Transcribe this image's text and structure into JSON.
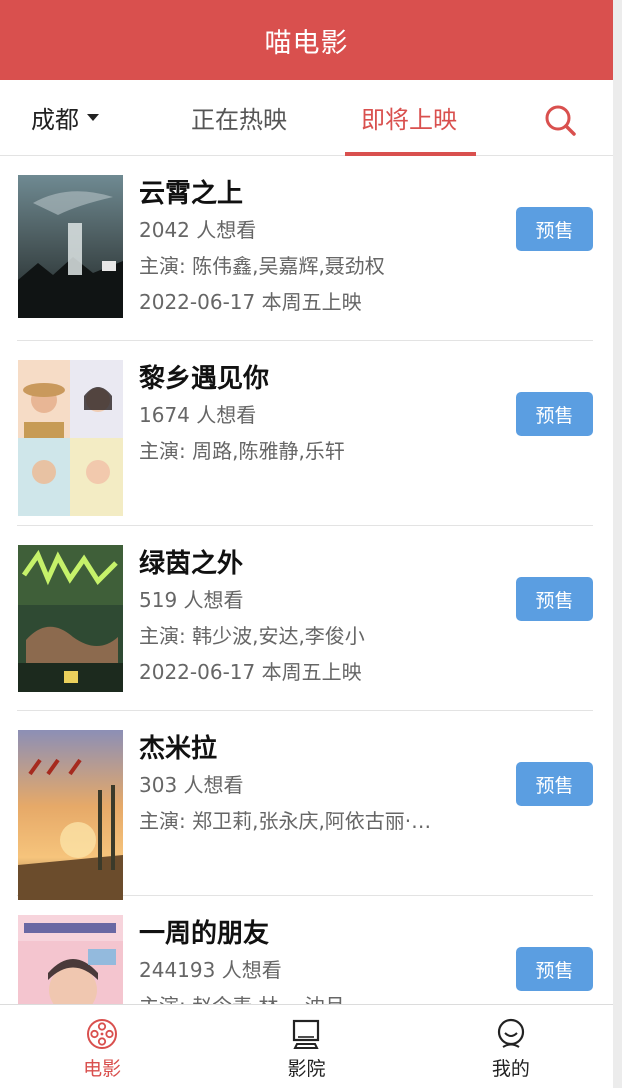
{
  "app": {
    "title": "喵电影"
  },
  "topnav": {
    "city": "成都",
    "tabs": [
      {
        "label": "正在热映",
        "active": false
      },
      {
        "label": "即将上映",
        "active": true
      }
    ]
  },
  "movies": [
    {
      "name": "云霄之上",
      "want": "2042 人想看",
      "cast": "主演: 陈伟鑫,吴嘉辉,聂劲权",
      "release": "2022-06-17 本周五上映",
      "button": "预售"
    },
    {
      "name": "黎乡遇见你",
      "want": "1674 人想看",
      "cast": "主演: 周路,陈雅静,乐轩",
      "release": "",
      "button": "预售"
    },
    {
      "name": "绿茵之外",
      "want": "519 人想看",
      "cast": "主演: 韩少波,安达,李俊小",
      "release": "2022-06-17 本周五上映",
      "button": "预售"
    },
    {
      "name": "杰米拉",
      "want": "303 人想看",
      "cast": "主演: 郑卫莉,张永庆,阿依古丽·…",
      "release": "",
      "button": "预售"
    },
    {
      "name": "一周的朋友",
      "want": "244193 人想看",
      "cast": "主演: 赵今麦,林一,沈月",
      "release": "",
      "button": "预售"
    }
  ],
  "bottomnav": [
    {
      "label": "电影",
      "icon": "film-reel-icon",
      "active": true
    },
    {
      "label": "影院",
      "icon": "cinema-screen-icon",
      "active": false
    },
    {
      "label": "我的",
      "icon": "user-face-icon",
      "active": false
    }
  ],
  "colors": {
    "brand": "#d9504e",
    "presale": "#5b9ee1"
  }
}
